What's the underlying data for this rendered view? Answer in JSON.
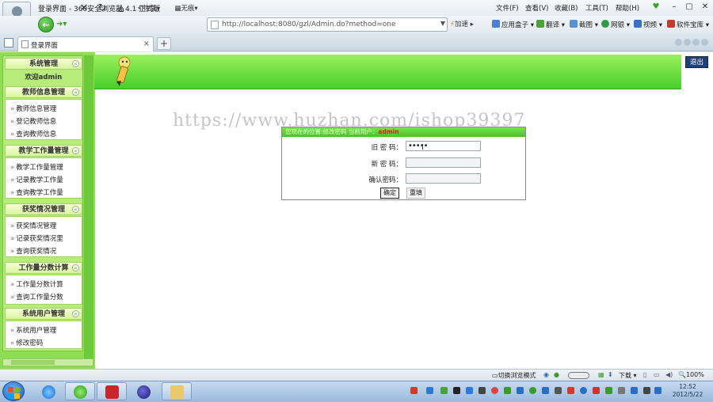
{
  "browser": {
    "window_title": "登录界面 - 360安全浏览器 4.1 正式版",
    "menu": [
      "文件(F)",
      "查看(V)",
      "收藏(B)",
      "工具(T)",
      "帮助(H)"
    ],
    "nav": {
      "back_icon": "back-arrow-icon",
      "history_label": "恢复",
      "noimg_label": "无痕",
      "address": "http://localhost:8080/gzl/Admin.do?method=one",
      "go_label": "加速"
    },
    "right_tools": [
      "应用盒子",
      "翻译",
      "截图",
      "网银",
      "视频",
      "软件宝库"
    ],
    "tab": {
      "label": "登录界面",
      "close": "×"
    },
    "new_tab": "+"
  },
  "sidebar": {
    "sections": [
      {
        "title": "系统管理",
        "items": []
      },
      {
        "title": "教师信息管理",
        "items": [
          "教师信息管理",
          "登记教师信息",
          "查询教师信息"
        ]
      },
      {
        "title": "教学工作量管理",
        "items": [
          "教学工作量管理",
          "记录教学工作量",
          "查询教学工作量"
        ]
      },
      {
        "title": "获奖情况管理",
        "items": [
          "获奖情况管理",
          "记录获奖情况里",
          "查询获奖情况"
        ]
      },
      {
        "title": "工作量分数计算",
        "items": [
          "工作量分数计算",
          "查询工作量分数"
        ]
      },
      {
        "title": "系统用户管理",
        "items": [
          "系统用户管理",
          "修改密码"
        ]
      }
    ],
    "welcome": "欢迎admin",
    "collapse_icon": "«"
  },
  "header": {
    "logout_label": "退出"
  },
  "watermark": "https://www.huzhan.com/ishop39397",
  "form": {
    "heading": "您现在的位置:修改密码",
    "heading_user_prefix": "当前用户：",
    "heading_user": "admin",
    "fields": [
      {
        "label": "旧 密 码：",
        "value": "•••••"
      },
      {
        "label": "新 密 码：",
        "value": ""
      },
      {
        "label": "确认密码：",
        "value": ""
      }
    ],
    "submit_label": "确定",
    "reset_label": "重填"
  },
  "statusbar": {
    "mode_label": "切换浏览模式",
    "download_label": "下载",
    "zoom": "100%"
  },
  "taskbar": {
    "time": "12:52",
    "date": "2012/5/22"
  },
  "colors": {
    "sidebar_green": "#8fdc55",
    "band_green": "#48cf2a",
    "logout_navy": "#1f3f7a"
  }
}
